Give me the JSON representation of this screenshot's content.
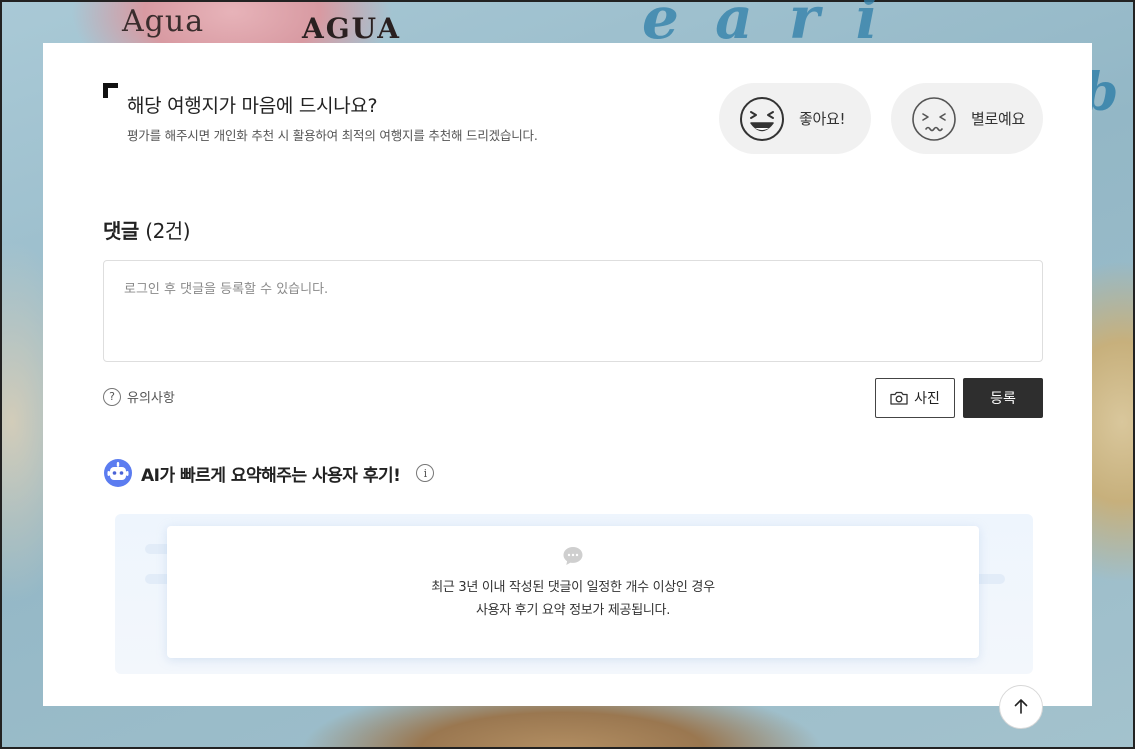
{
  "background": {
    "map_text_1": "Agua",
    "map_text_2": "AGUA",
    "map_text_3": "e a r i",
    "map_text_4": "b"
  },
  "rating": {
    "title": "해당 여행지가 마음에 드시나요?",
    "subtitle": "평가를 해주시면 개인화 추천 시 활용하여 최적의 여행지를 추천해 드리겠습니다.",
    "like_label": "좋아요!",
    "dislike_label": "별로예요",
    "like_icon": "laughing-face-icon",
    "dislike_icon": "sad-face-icon"
  },
  "comments": {
    "title": "댓글",
    "count": "(2건)",
    "placeholder": "로그인 후 댓글을 등록할 수 있습니다.",
    "notice_label": "유의사항",
    "photo_label": "사진",
    "submit_label": "등록"
  },
  "ai_summary": {
    "title": "AI가 빠르게 요약해주는 사용자 후기!",
    "empty_line1": "최근 3년 이내 작성된 댓글이 일정한 개수 이상인 경우",
    "empty_line2": "사용자 후기 요약 정보가 제공됩니다."
  },
  "colors": {
    "accent_dark": "#2e2e2e",
    "react_bg": "#f1f1f1",
    "ai_panel_bg": "#eef5fd"
  }
}
